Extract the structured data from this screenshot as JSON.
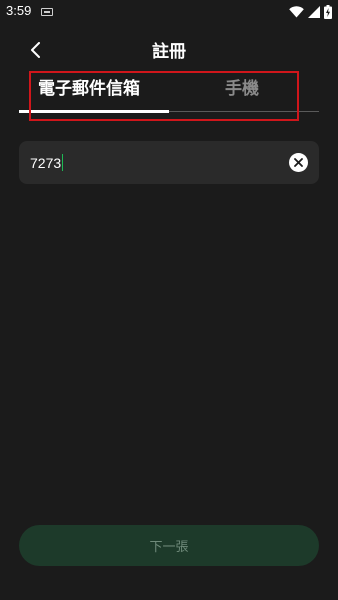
{
  "status_bar": {
    "time": "3:59",
    "icons": [
      "keyboard-icon",
      "wifi-icon",
      "signal-icon",
      "battery-charging-icon"
    ]
  },
  "header": {
    "title": "註冊",
    "back_icon": "chevron-left-icon"
  },
  "tabs": [
    {
      "label": "電子郵件信箱",
      "active": true
    },
    {
      "label": "手機",
      "active": false
    }
  ],
  "input": {
    "value": "7273",
    "clear_icon": "clear-icon"
  },
  "footer": {
    "next_label": "下一張"
  },
  "colors": {
    "background": "#1b1b1b",
    "input_bg": "#2a2a2a",
    "button_disabled_bg": "#1d3a2a",
    "caret": "#1db954",
    "highlight": "#d0161b"
  }
}
